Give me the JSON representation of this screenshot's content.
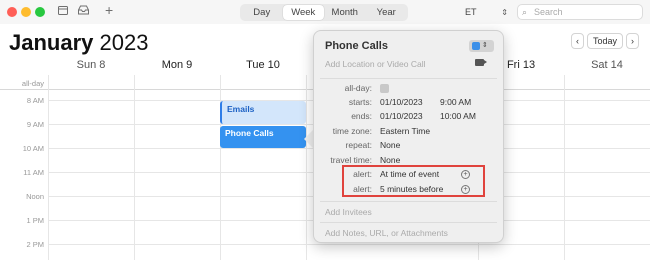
{
  "toolbar": {
    "views": [
      "Day",
      "Week",
      "Month",
      "Year"
    ],
    "active_view": "Week",
    "timezone": "ET",
    "search_placeholder": "Search",
    "add_label": "+"
  },
  "header": {
    "month": "January",
    "year": "2023",
    "today_label": "Today",
    "prev_label": "‹",
    "next_label": "›"
  },
  "week": {
    "days": [
      "Sun 8",
      "Mon 9",
      "Tue 10",
      "Fri 13",
      "Sat 14"
    ],
    "allday_label": "all-day",
    "times": [
      "8 AM",
      "9 AM",
      "10 AM",
      "11 AM",
      "Noon",
      "1 PM",
      "2 PM"
    ]
  },
  "events": {
    "emails": "Emails",
    "phone": "Phone Calls"
  },
  "popover": {
    "title": "Phone Calls",
    "location_placeholder": "Add Location or Video Call",
    "allday_label": "all-day:",
    "starts_label": "starts:",
    "starts_date": "01/10/2023",
    "starts_time": "9:00 AM",
    "ends_label": "ends:",
    "ends_date": "01/10/2023",
    "ends_time": "10:00 AM",
    "timezone_label": "time zone:",
    "timezone_value": "Eastern Time",
    "repeat_label": "repeat:",
    "repeat_value": "None",
    "travel_label": "travel time:",
    "travel_value": "None",
    "alert1_label": "alert:",
    "alert1_value": "At time of event",
    "alert2_label": "alert:",
    "alert2_value": "5 minutes before",
    "invitees_placeholder": "Add Invitees",
    "notes_placeholder": "Add Notes, URL, or Attachments"
  },
  "colors": {
    "accent": "#3492f0",
    "highlight": "#e0433d"
  }
}
